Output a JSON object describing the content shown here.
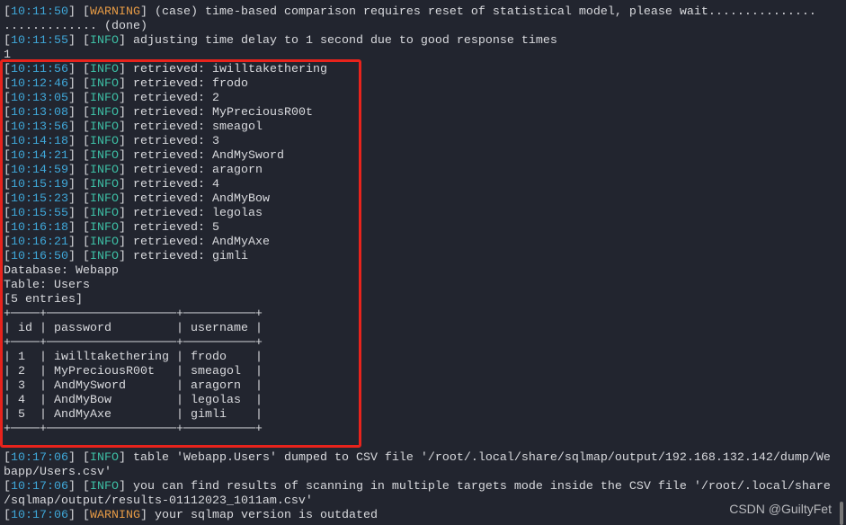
{
  "colors": {
    "background": "#22252f",
    "timestamp": "#3fa7d8",
    "info": "#3dbfa5",
    "warning": "#e59a45",
    "highlight_box": "#e8231c"
  },
  "log_top": [
    {
      "ts": "10:11:50",
      "level": "WARNING",
      "msg": " (case) time-based comparison requires reset of statistical model, please wait..............."
    },
    {
      "text": "............. (done)"
    },
    {
      "ts": "10:11:55",
      "level": "INFO",
      "msg": " adjusting time delay to 1 second due to good response times"
    },
    {
      "text": "1"
    }
  ],
  "retrieved": [
    {
      "ts": "10:11:56",
      "level": "INFO",
      "msg": " retrieved: iwilltakethering"
    },
    {
      "ts": "10:12:46",
      "level": "INFO",
      "msg": " retrieved: frodo"
    },
    {
      "ts": "10:13:05",
      "level": "INFO",
      "msg": " retrieved: 2"
    },
    {
      "ts": "10:13:08",
      "level": "INFO",
      "msg": " retrieved: MyPreciousR00t"
    },
    {
      "ts": "10:13:56",
      "level": "INFO",
      "msg": " retrieved: smeagol"
    },
    {
      "ts": "10:14:18",
      "level": "INFO",
      "msg": " retrieved: 3"
    },
    {
      "ts": "10:14:21",
      "level": "INFO",
      "msg": " retrieved: AndMySword"
    },
    {
      "ts": "10:14:59",
      "level": "INFO",
      "msg": " retrieved: aragorn"
    },
    {
      "ts": "10:15:19",
      "level": "INFO",
      "msg": " retrieved: 4"
    },
    {
      "ts": "10:15:23",
      "level": "INFO",
      "msg": " retrieved: AndMyBow"
    },
    {
      "ts": "10:15:55",
      "level": "INFO",
      "msg": " retrieved: legolas"
    },
    {
      "ts": "10:16:18",
      "level": "INFO",
      "msg": " retrieved: 5"
    },
    {
      "ts": "10:16:21",
      "level": "INFO",
      "msg": " retrieved: AndMyAxe"
    },
    {
      "ts": "10:16:50",
      "level": "INFO",
      "msg": " retrieved: gimli"
    }
  ],
  "dump": {
    "database": "Database: Webapp",
    "table": "Table: Users",
    "entries": "[5 entries]",
    "columns": [
      "id",
      "password",
      "username"
    ],
    "rows": [
      [
        "1",
        "iwilltakethering",
        "frodo"
      ],
      [
        "2",
        "MyPreciousR00t",
        "smeagol"
      ],
      [
        "3",
        "AndMySword",
        "aragorn"
      ],
      [
        "4",
        "AndMyBow",
        "legolas"
      ],
      [
        "5",
        "AndMyAxe",
        "gimli"
      ]
    ]
  },
  "log_bottom": [
    {
      "ts": "10:17:06",
      "level": "INFO",
      "msg": " table 'Webapp.Users' dumped to CSV file '/root/.local/share/sqlmap/output/192.168.132.142/dump/We"
    },
    {
      "text": "bapp/Users.csv'"
    },
    {
      "ts": "10:17:06",
      "level": "INFO",
      "msg": " you can find results of scanning in multiple targets mode inside the CSV file '/root/.local/share"
    },
    {
      "text": "/sqlmap/output/results-01112023_1011am.csv'"
    },
    {
      "ts": "10:17:06",
      "level": "WARNING",
      "msg": " your sqlmap version is outdated"
    }
  ],
  "watermark": "CSDN @GuiltyFet"
}
